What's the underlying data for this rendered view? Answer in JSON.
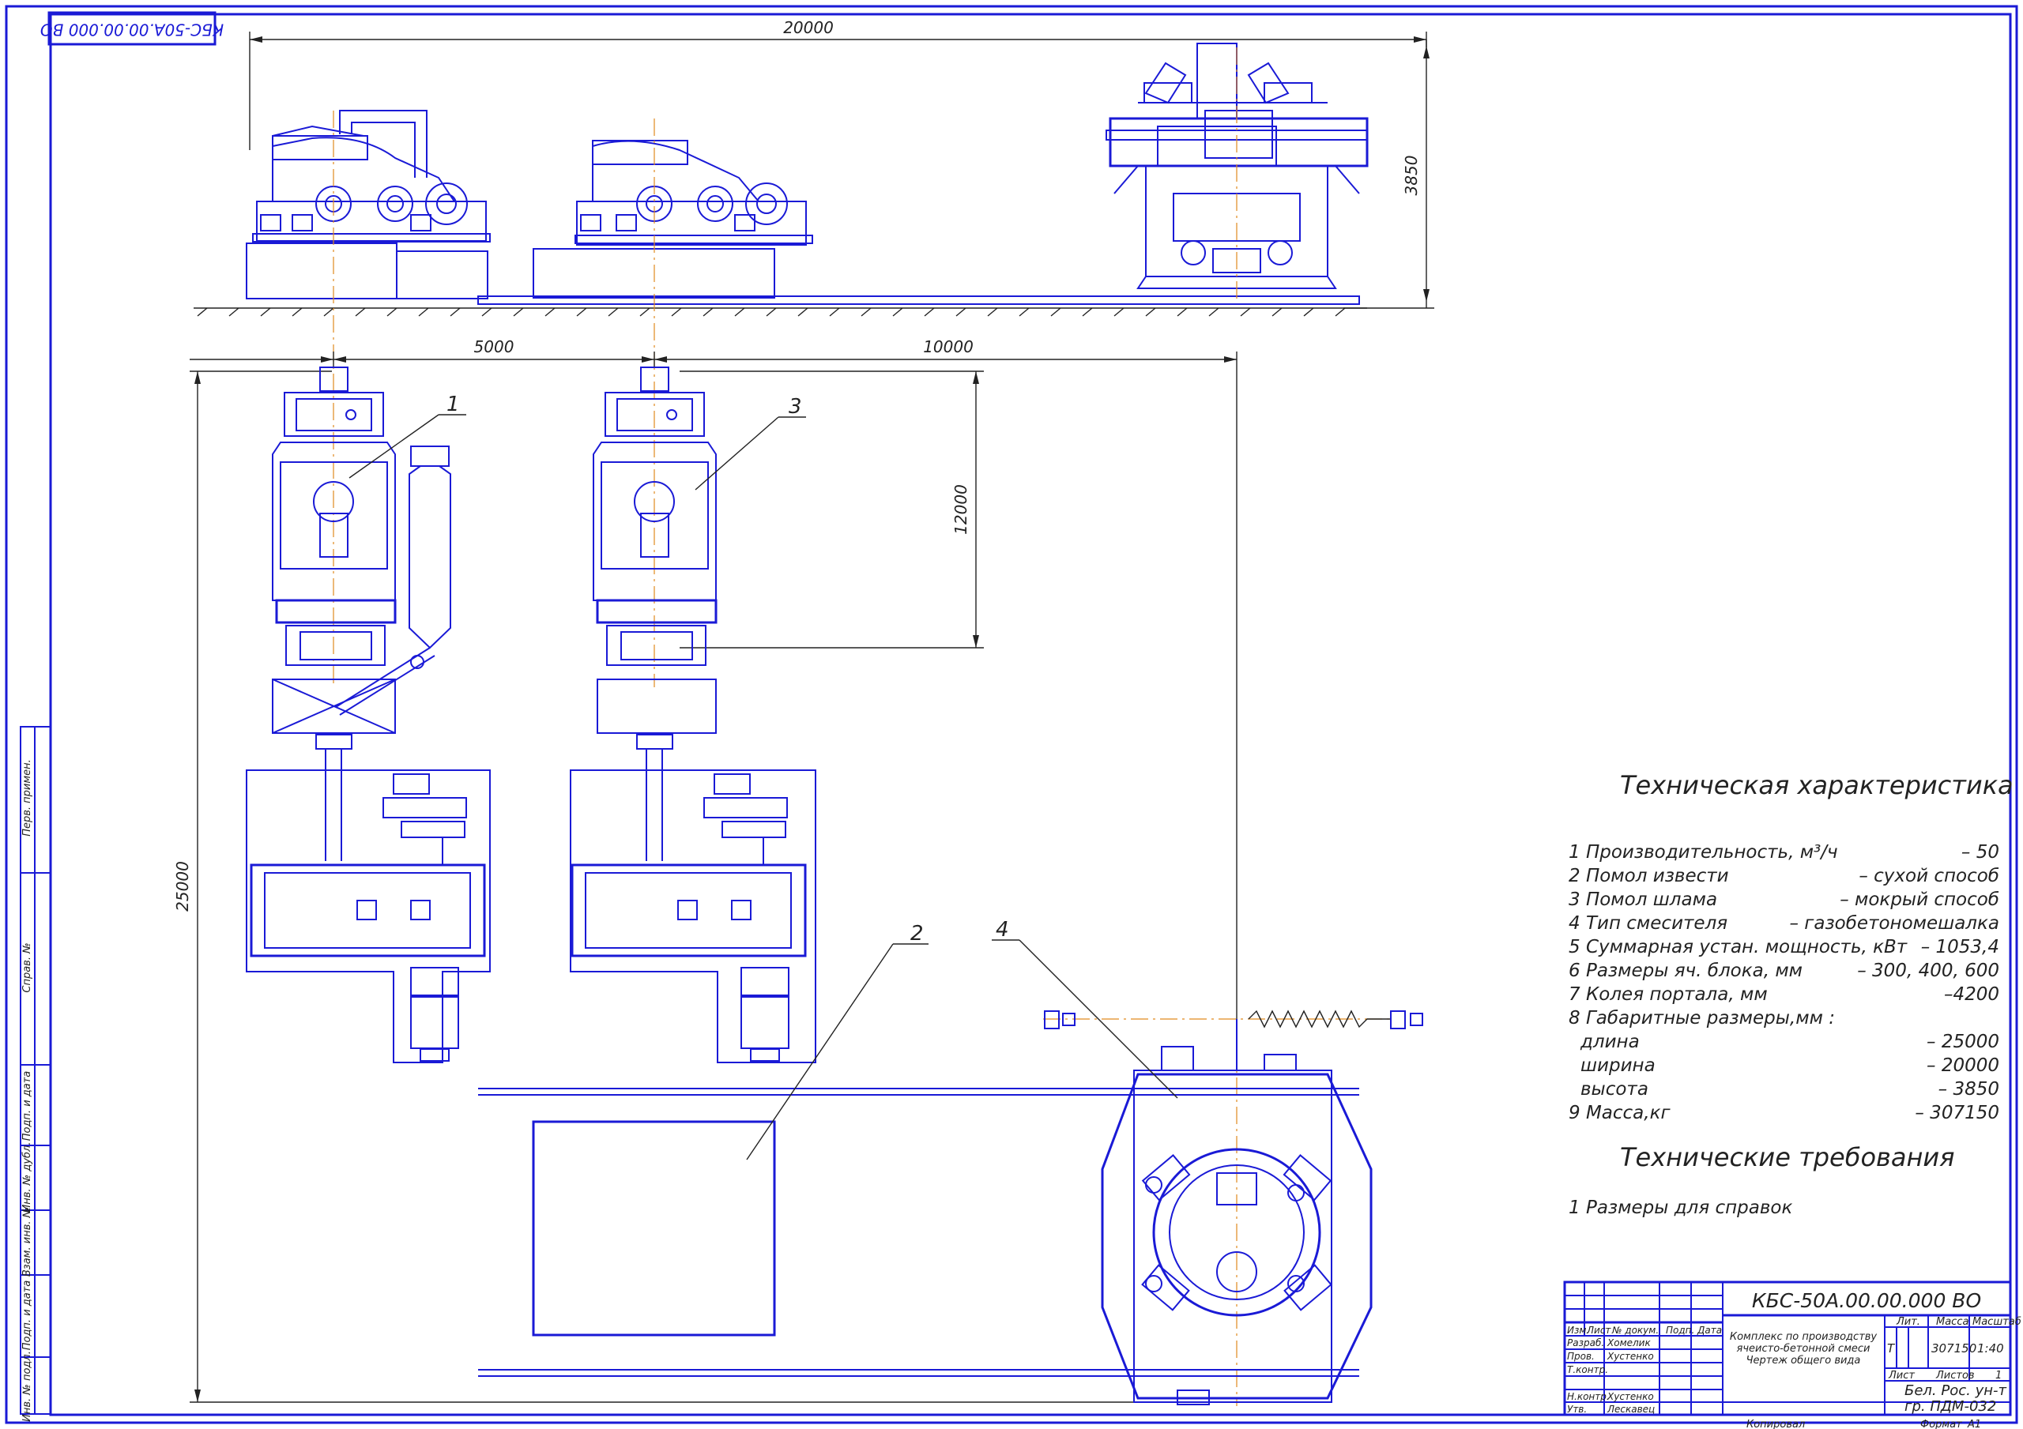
{
  "corner_stamp": "КБС-50А.00.00.000 ВО",
  "dimensions": {
    "overall_width": "20000",
    "height": "3850",
    "span_a": "5000",
    "span_b": "10000",
    "vertical_a": "12000",
    "overall_length": "25000"
  },
  "callouts": [
    "1",
    "2",
    "3",
    "4"
  ],
  "specs": {
    "title": "Техническая характеристика",
    "items": [
      {
        "label": "1 Производительность, м³/ч",
        "value": "– 50"
      },
      {
        "label": "2 Помол извести",
        "value": "– сухой способ"
      },
      {
        "label": "3 Помол шлама",
        "value": "– мокрый способ"
      },
      {
        "label": "4 Тип смесителя",
        "value": "– газобетономешалка"
      },
      {
        "label": "5 Суммарная устан. мощность, кВт",
        "value": "– 1053,4"
      },
      {
        "label": "6 Размеры яч. блока, мм",
        "value": "– 300, 400, 600"
      },
      {
        "label": "7 Колея портала, мм",
        "value": "–4200"
      },
      {
        "label": "8 Габаритные размеры,мм :",
        "value": ""
      },
      {
        "label": "длина",
        "value": "– 25000"
      },
      {
        "label": "ширина",
        "value": "– 20000"
      },
      {
        "label": "высота",
        "value": "– 3850"
      },
      {
        "label": "9 Масса,кг",
        "value": "– 307150"
      }
    ]
  },
  "requirements": {
    "title": "Технические требования",
    "items": [
      "1  Размеры для справок"
    ]
  },
  "side_strip": [
    "Перв. примен.",
    "Справ. №",
    "Подп. и дата",
    "Инв. № дубл.",
    "Взам. инв. №",
    "Подп. и дата",
    "Инв. № подл."
  ],
  "title_block": {
    "designation": "КБС-50А.00.00.000 ВО",
    "name_line1": "Комплекс по производству",
    "name_line2": "ячеисто-бетонной смеси",
    "name_line3": "Чертеж общего вида",
    "col_headers": [
      "Изм.",
      "Лист",
      "№ докум.",
      "Подп.",
      "Дата"
    ],
    "roles": [
      {
        "role": "Разраб.",
        "name": "Хомелик"
      },
      {
        "role": "Пров.",
        "name": "Хустенко"
      },
      {
        "role": "Т.контр.",
        "name": ""
      },
      {
        "role": "Н.контр.",
        "name": "Хустенко"
      },
      {
        "role": "Утв.",
        "name": "Лескавец"
      }
    ],
    "lit_label": "Лит.",
    "mass_label": "Масса",
    "scale_label": "Масштаб",
    "lit_value": "Т",
    "mass_value": "307150",
    "scale_value": "1:40",
    "sheet_label": "Лист",
    "sheets_label": "Листов",
    "sheets_value": "1",
    "org_line1": "Бел. Рос. ун-т",
    "org_line2": "гр. ПДМ-032",
    "copied": "Копировал",
    "format": "Формат",
    "format_value": "А1"
  }
}
